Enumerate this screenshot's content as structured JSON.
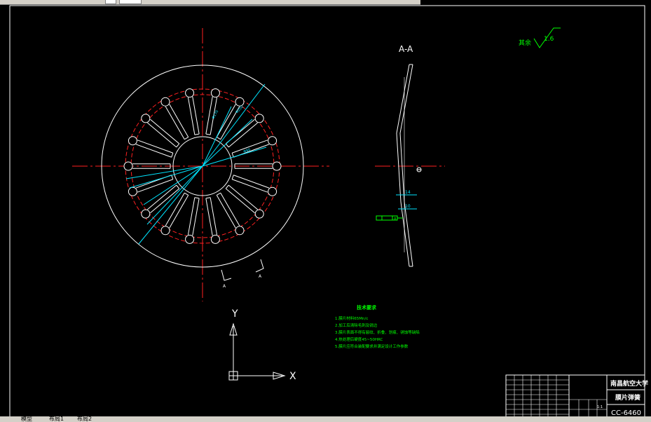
{
  "section_label": "A-A",
  "roughness": {
    "label": "其余",
    "value": "1.6"
  },
  "cut_marks": {
    "left": "A",
    "right": "A"
  },
  "section_dims": {
    "d1": "14",
    "d2": "10",
    "datum": "A"
  },
  "tech_requirements": {
    "title": "技术要求",
    "items": [
      "1.膜片材料65Mn/c",
      "2.加工后清除毛刺及锐边",
      "3.膜片表面不得有裂纹、折叠、划痕、锈蚀等缺陷",
      "4.热处理后硬度45~50HRC",
      "5.膜片应符合装配要求并满足设计工作参数"
    ]
  },
  "ucs": {
    "y": "Y",
    "x": "X"
  },
  "title_block": {
    "school": "南昌航空大学",
    "part_name": "膜片弹簧",
    "drawing_no": "CC-6460",
    "scale": "1:1"
  },
  "status": {
    "model_tab": "模型",
    "layout1": "布局1",
    "layout2": "布局2"
  },
  "colors": {
    "background": "#000000",
    "outline": "#ffffff",
    "center_line": "#ff0000",
    "dimension": "#00ffff",
    "text_green": "#00ff00",
    "frame": "#ffffff"
  }
}
